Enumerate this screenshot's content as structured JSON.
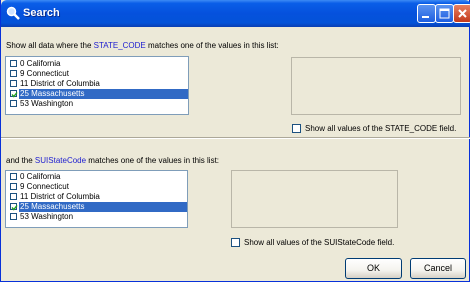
{
  "window": {
    "title": "Search"
  },
  "section1": {
    "prompt_prefix": "Show all data where the ",
    "field": "STATE_CODE",
    "prompt_suffix": " matches one of the values in this list:",
    "items": [
      {
        "label": "0 California",
        "checked": false,
        "selected": false
      },
      {
        "label": "9 Connecticut",
        "checked": false,
        "selected": false
      },
      {
        "label": "11 District of Columbia",
        "checked": false,
        "selected": false
      },
      {
        "label": "25 Massachusetts",
        "checked": true,
        "selected": true
      },
      {
        "label": "53 Washington",
        "checked": false,
        "selected": false
      }
    ],
    "show_all_label": "Show all values of the STATE_CODE field.",
    "show_all_checked": false
  },
  "section2": {
    "prompt_prefix": "and the ",
    "field": "SUIStateCode",
    "prompt_suffix": " matches one of the values in this list:",
    "items": [
      {
        "label": "0 California",
        "checked": false,
        "selected": false
      },
      {
        "label": "9 Connecticut",
        "checked": false,
        "selected": false
      },
      {
        "label": "11 District of Columbia",
        "checked": false,
        "selected": false
      },
      {
        "label": "25 Massachusetts",
        "checked": true,
        "selected": true
      },
      {
        "label": "53 Washington",
        "checked": false,
        "selected": false
      }
    ],
    "show_all_label": "Show all values of the SUIStateCode field.",
    "show_all_checked": false
  },
  "buttons": {
    "ok": "OK",
    "cancel": "Cancel"
  }
}
